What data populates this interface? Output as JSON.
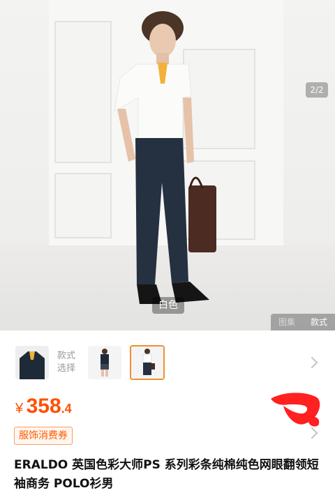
{
  "gallery": {
    "page_indicator": "2/2",
    "color_label": "白色",
    "view_gallery": "图集",
    "view_style": "款式"
  },
  "thumbnails": {
    "select_label": "款式\n选择",
    "count": 3,
    "selected_index": 2
  },
  "price": {
    "currency": "¥",
    "integer": "358",
    "decimal": ".4"
  },
  "coupon": {
    "label": "服饰消费券"
  },
  "product": {
    "title": "ERALDO 英国色彩大师PS 系列彩条纯棉纯色网眼翻领短袖商务 POLO衫男"
  },
  "colors": {
    "accent": "#ff5000",
    "selected_border": "#ef8f2f",
    "scribble": "#ff2020"
  }
}
